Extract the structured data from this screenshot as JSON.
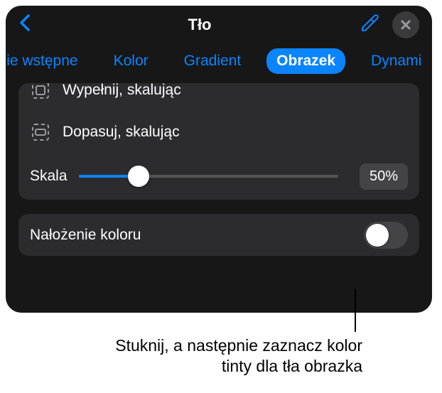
{
  "header": {
    "title": "Tło"
  },
  "tabs": {
    "preset": "wienie wstępne",
    "color": "Kolor",
    "gradient": "Gradient",
    "image": "Obrazek",
    "dynamic": "Dynami"
  },
  "options": {
    "scale_fill": "Wypełnij, skalując",
    "scale_fit": "Dopasuj, skalując",
    "scale_label": "Skala",
    "scale_value": "50%"
  },
  "overlay": {
    "label": "Nałożenie koloru"
  },
  "callout": {
    "text": "Stuknij, a następnie zaznacz kolor tinty dla tła obrazka"
  }
}
